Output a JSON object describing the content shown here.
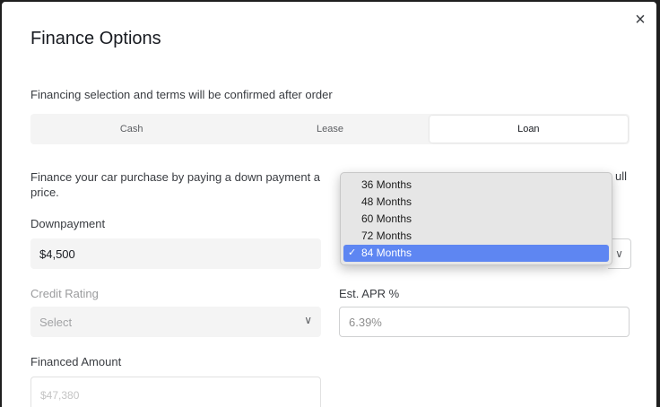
{
  "modal": {
    "title": "Finance Options",
    "close_icon": "×",
    "subtitle": "Financing selection and terms will be confirmed after order"
  },
  "tabs": [
    {
      "label": "Cash",
      "active": false
    },
    {
      "label": "Lease",
      "active": false
    },
    {
      "label": "Loan",
      "active": true
    }
  ],
  "description": {
    "text": "Finance your car purchase by paying a down payment a",
    "line2": "price.",
    "end_fragment": "ull"
  },
  "downpayment": {
    "label": "Downpayment",
    "value": "$4,500"
  },
  "term_dropdown": {
    "options": [
      "36 Months",
      "48 Months",
      "60 Months",
      "72 Months",
      "84 Months"
    ],
    "selected": "84 Months",
    "check_glyph": "✓"
  },
  "credit_rating": {
    "label": "Credit Rating",
    "placeholder": "Select"
  },
  "apr": {
    "label": "Est. APR %",
    "value": "6.39%"
  },
  "financed_amount": {
    "label": "Financed Amount",
    "value": "$47,380"
  },
  "colors": {
    "accent_selected": "#5e86f2",
    "segment_bg": "#f4f4f4"
  },
  "icons": {
    "chevron": "∨"
  }
}
